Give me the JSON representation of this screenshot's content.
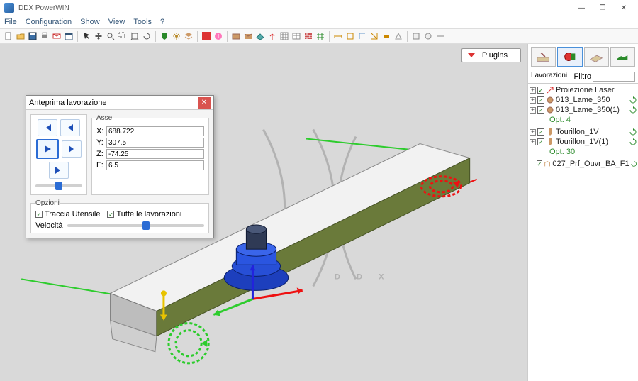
{
  "app": {
    "title": "DDX PowerWIN"
  },
  "menu": [
    "File",
    "Configuration",
    "Show",
    "View",
    "Tools",
    "?"
  ],
  "window_controls": {
    "min": "—",
    "max": "❐",
    "close": "✕"
  },
  "plugins": {
    "label": "Plugins"
  },
  "dialog": {
    "title": "Anteprima lavorazione",
    "close": "✕",
    "axes_legend": "Asse",
    "axes": {
      "X": "688.722",
      "Y": "307.5",
      "Z": "-74.25",
      "F": "6.5"
    },
    "options_legend": "Opzioni",
    "traccia": "Traccia Utensile",
    "tutte": "Tutte le lavorazioni",
    "velocita": "Velocità"
  },
  "rightpanel": {
    "lavorazioni": "Lavorazioni",
    "filtro": "Filtro",
    "filter_value": "",
    "tree": [
      {
        "label": "Proiezione Laser"
      },
      {
        "label": "013_Lame_350"
      },
      {
        "label": "013_Lame_350(1)"
      },
      {
        "opt": "Opt. 4"
      },
      {
        "sep": true
      },
      {
        "label": "Tourillon_1V"
      },
      {
        "label": "Tourillon_1V(1)"
      },
      {
        "opt": "Opt. 30"
      },
      {
        "sep": true
      },
      {
        "label": "027_Prf_Ouvr_BA_F1"
      }
    ]
  },
  "watermark": "D  D  X"
}
